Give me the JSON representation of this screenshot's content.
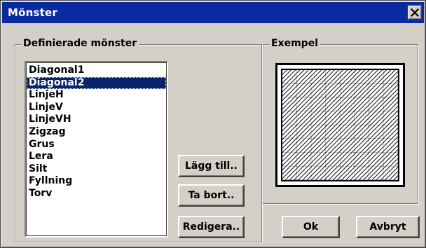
{
  "window": {
    "title": "Mönster",
    "close_label": "×"
  },
  "defined_patterns": {
    "legend": "Definierade mönster",
    "items": [
      "Diagonal1",
      "Diagonal2",
      "LinjeH",
      "LinjeV",
      "LinjeVH",
      "Zigzag",
      "Grus",
      "Lera",
      "Silt",
      "Fyllning",
      "Torv"
    ],
    "selected": "Diagonal2"
  },
  "actions": {
    "add_label": "Lägg till..",
    "remove_label": "Ta bort..",
    "edit_label": "Redigera.."
  },
  "example": {
    "legend": "Exempel",
    "pattern": "diagonal-crosshatch"
  },
  "footer": {
    "ok_label": "Ok",
    "cancel_label": "Avbryt"
  },
  "colors": {
    "titlebar": "#0a2aa0",
    "selection": "#0a246a",
    "face": "#d4d0c8"
  }
}
